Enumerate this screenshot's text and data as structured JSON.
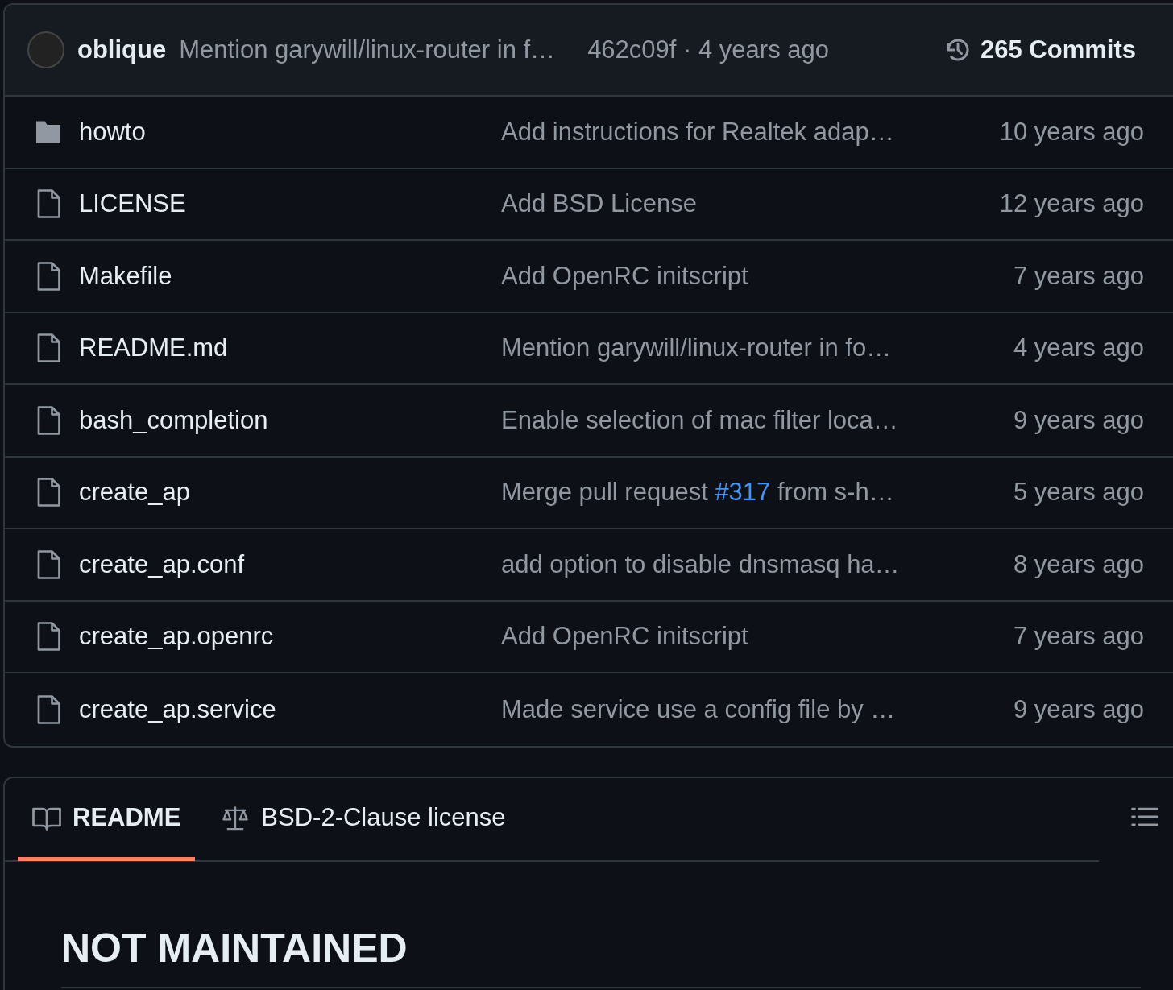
{
  "latest_commit": {
    "author": "oblique",
    "message": "Mention garywill/linux-router in f…",
    "sha_time": "462c09f · 4 years ago",
    "commits": "265 Commits"
  },
  "files": [
    {
      "kind": "folder",
      "name": "howto",
      "message": [
        {
          "kind": "text",
          "text": "Add instructions for Realtek adap…"
        }
      ],
      "time": "10 years ago"
    },
    {
      "kind": "file",
      "name": "LICENSE",
      "message": [
        {
          "kind": "text",
          "text": "Add BSD License"
        }
      ],
      "time": "12 years ago"
    },
    {
      "kind": "file",
      "name": "Makefile",
      "message": [
        {
          "kind": "text",
          "text": "Add OpenRC initscript"
        }
      ],
      "time": "7 years ago"
    },
    {
      "kind": "file",
      "name": "README.md",
      "message": [
        {
          "kind": "text",
          "text": "Mention garywill/linux-router in fo…"
        }
      ],
      "time": "4 years ago"
    },
    {
      "kind": "file",
      "name": "bash_completion",
      "message": [
        {
          "kind": "text",
          "text": "Enable selection of mac filter loca…"
        }
      ],
      "time": "9 years ago"
    },
    {
      "kind": "file",
      "name": "create_ap",
      "message": [
        {
          "kind": "text",
          "text": "Merge pull request "
        },
        {
          "kind": "link",
          "text": "#317"
        },
        {
          "kind": "text",
          "text": " from s-h…"
        }
      ],
      "time": "5 years ago"
    },
    {
      "kind": "file",
      "name": "create_ap.conf",
      "message": [
        {
          "kind": "text",
          "text": "add option to disable dnsmasq ha…"
        }
      ],
      "time": "8 years ago"
    },
    {
      "kind": "file",
      "name": "create_ap.openrc",
      "message": [
        {
          "kind": "text",
          "text": "Add OpenRC initscript"
        }
      ],
      "time": "7 years ago"
    },
    {
      "kind": "file",
      "name": "create_ap.service",
      "message": [
        {
          "kind": "text",
          "text": "Made service use a config file by …"
        }
      ],
      "time": "9 years ago"
    }
  ],
  "readme_tabs": [
    {
      "kind": "book",
      "label": "README",
      "selected": true
    },
    {
      "kind": "scale",
      "label": "BSD-2-Clause license",
      "selected": false
    }
  ],
  "readme_heading": "NOT MAINTAINED"
}
